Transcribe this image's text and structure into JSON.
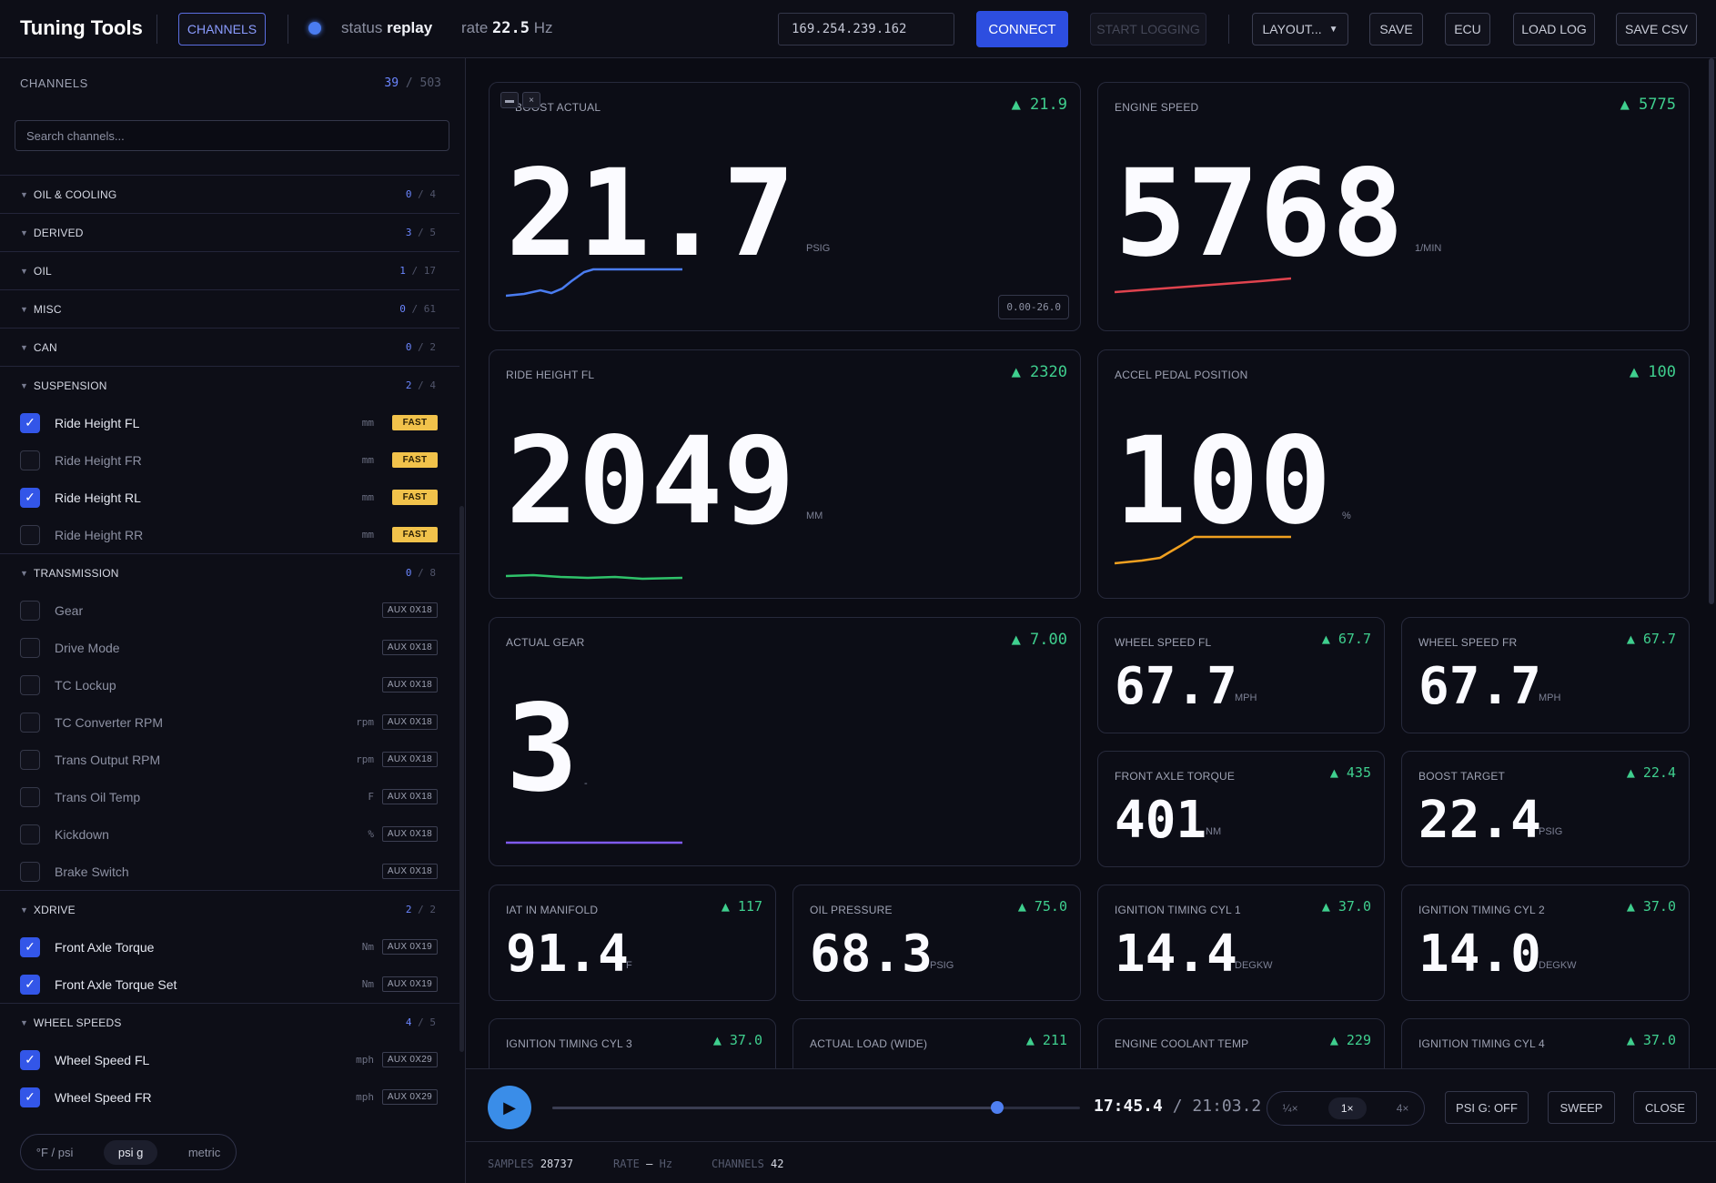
{
  "app": {
    "title": "Tuning Tools"
  },
  "topbar": {
    "channels_label": "CHANNELS",
    "status_label": "status",
    "status_value": "replay",
    "rate_label": "rate",
    "rate_value": "22.5",
    "rate_unit": "Hz",
    "ip_value": "169.254.239.162",
    "connect_label": "CONNECT",
    "start_logging_label": "START LOGGING",
    "layout_label": "LAYOUT...",
    "save_label": "SAVE",
    "ecu_label": "ECU",
    "load_log_label": "LOAD LOG",
    "save_csv_label": "SAVE CSV"
  },
  "sidebar": {
    "header": "CHANNELS",
    "selected": "39",
    "total": "503",
    "sep": "/",
    "search_placeholder": "Search channels...",
    "groups": [
      {
        "name": "OIL & COOLING",
        "sel": "0",
        "total": "4"
      },
      {
        "name": "DERIVED",
        "sel": "3",
        "total": "5"
      },
      {
        "name": "OIL",
        "sel": "1",
        "total": "17"
      },
      {
        "name": "MISC",
        "sel": "0",
        "total": "61"
      },
      {
        "name": "CAN",
        "sel": "0",
        "total": "2"
      },
      {
        "name": "SUSPENSION",
        "sel": "2",
        "total": "4",
        "items": [
          {
            "label": "Ride Height FL",
            "unit": "mm",
            "tag": "FAST",
            "checked": true
          },
          {
            "label": "Ride Height FR",
            "unit": "mm",
            "tag": "FAST",
            "checked": false
          },
          {
            "label": "Ride Height RL",
            "unit": "mm",
            "tag": "FAST",
            "checked": true
          },
          {
            "label": "Ride Height RR",
            "unit": "mm",
            "tag": "FAST",
            "checked": false
          }
        ]
      },
      {
        "name": "TRANSMISSION",
        "sel": "0",
        "total": "8",
        "items": [
          {
            "label": "Gear",
            "unit": "",
            "tag": "AUX 0X18",
            "checked": false
          },
          {
            "label": "Drive Mode",
            "unit": "",
            "tag": "AUX 0X18",
            "checked": false
          },
          {
            "label": "TC Lockup",
            "unit": "",
            "tag": "AUX 0X18",
            "checked": false
          },
          {
            "label": "TC Converter RPM",
            "unit": "rpm",
            "tag": "AUX 0X18",
            "checked": false
          },
          {
            "label": "Trans Output RPM",
            "unit": "rpm",
            "tag": "AUX 0X18",
            "checked": false
          },
          {
            "label": "Trans Oil Temp",
            "unit": "F",
            "tag": "AUX 0X18",
            "checked": false
          },
          {
            "label": "Kickdown",
            "unit": "%",
            "tag": "AUX 0X18",
            "checked": false
          },
          {
            "label": "Brake Switch",
            "unit": "",
            "tag": "AUX 0X18",
            "checked": false
          }
        ]
      },
      {
        "name": "XDRIVE",
        "sel": "2",
        "total": "2",
        "items": [
          {
            "label": "Front Axle Torque",
            "unit": "Nm",
            "tag": "AUX 0X19",
            "checked": true
          },
          {
            "label": "Front Axle Torque Set",
            "unit": "Nm",
            "tag": "AUX 0X19",
            "checked": true
          }
        ]
      },
      {
        "name": "WHEEL SPEEDS",
        "sel": "4",
        "total": "5",
        "items": [
          {
            "label": "Wheel Speed FL",
            "unit": "mph",
            "tag": "AUX 0X29",
            "checked": true
          },
          {
            "label": "Wheel Speed FR",
            "unit": "mph",
            "tag": "AUX 0X29",
            "checked": true
          }
        ]
      }
    ],
    "units_toggle": {
      "opt1": "°F / psi",
      "opt2": "psi g",
      "opt3": "metric",
      "active": "psi g"
    }
  },
  "tiles": {
    "boost": {
      "label": "BOOST ACTUAL",
      "max": "▲ 21.9",
      "value": "21.7",
      "unit": "PSIG",
      "range": "0.00-26.0",
      "color": "#4a7cf0"
    },
    "rpm": {
      "label": "ENGINE SPEED",
      "max": "▲ 5775",
      "value": "5768",
      "unit": "1/MIN",
      "color": "#e0434e"
    },
    "ride": {
      "label": "RIDE HEIGHT FL",
      "max": "▲ 2320",
      "value": "2049",
      "unit": "MM",
      "color": "#2fc26a"
    },
    "pedal": {
      "label": "ACCEL PEDAL POSITION",
      "max": "▲ 100",
      "value": "100",
      "unit": "%",
      "color": "#f0a020"
    },
    "gear": {
      "label": "ACTUAL GEAR",
      "max": "▲ 7.00",
      "value": "3",
      "unit": "-",
      "color": "#7f5af0"
    },
    "wsfl": {
      "label": "WHEEL SPEED FL",
      "max": "▲ 67.7",
      "value": "67.7",
      "unit": "MPH"
    },
    "wsfr": {
      "label": "WHEEL SPEED FR",
      "max": "▲ 67.7",
      "value": "67.7",
      "unit": "MPH"
    },
    "fat": {
      "label": "FRONT AXLE TORQUE",
      "max": "▲ 435",
      "value": "401",
      "unit": "NM"
    },
    "bt": {
      "label": "BOOST TARGET",
      "max": "▲ 22.4",
      "value": "22.4",
      "unit": "PSIG"
    },
    "iat": {
      "label": "IAT IN MANIFOLD",
      "max": "▲ 117",
      "value": "91.4",
      "unit": "F"
    },
    "oilp": {
      "label": "OIL PRESSURE",
      "max": "▲ 75.0",
      "value": "68.3",
      "unit": "PSIG"
    },
    "ign1": {
      "label": "IGNITION TIMING CYL 1",
      "max": "▲ 37.0",
      "value": "14.4",
      "unit": "DEGKW"
    },
    "ign2": {
      "label": "IGNITION TIMING CYL 2",
      "max": "▲ 37.0",
      "value": "14.0",
      "unit": "DEGKW"
    },
    "ign3": {
      "label": "IGNITION TIMING CYL 3",
      "max": "▲ 37.0"
    },
    "load": {
      "label": "ACTUAL LOAD (WIDE)",
      "max": "▲ 211"
    },
    "ect": {
      "label": "ENGINE COOLANT TEMP",
      "max": "▲ 229"
    },
    "ign4": {
      "label": "IGNITION TIMING CYL 4",
      "max": "▲ 37.0"
    }
  },
  "playback": {
    "current": "17:45.4",
    "sep": "/",
    "total": "21:03.2",
    "progress": 0.843,
    "speeds": [
      "¼×",
      "1×",
      "4×"
    ],
    "active_speed": "1×",
    "psig_label": "PSI G: OFF",
    "sweep_label": "SWEEP",
    "close_label": "CLOSE"
  },
  "statusbar": {
    "samples_label": "SAMPLES",
    "samples_value": "28737",
    "rate_label": "RATE",
    "rate_value": "—",
    "rate_unit": "Hz",
    "channels_label": "CHANNELS",
    "channels_value": "42"
  }
}
